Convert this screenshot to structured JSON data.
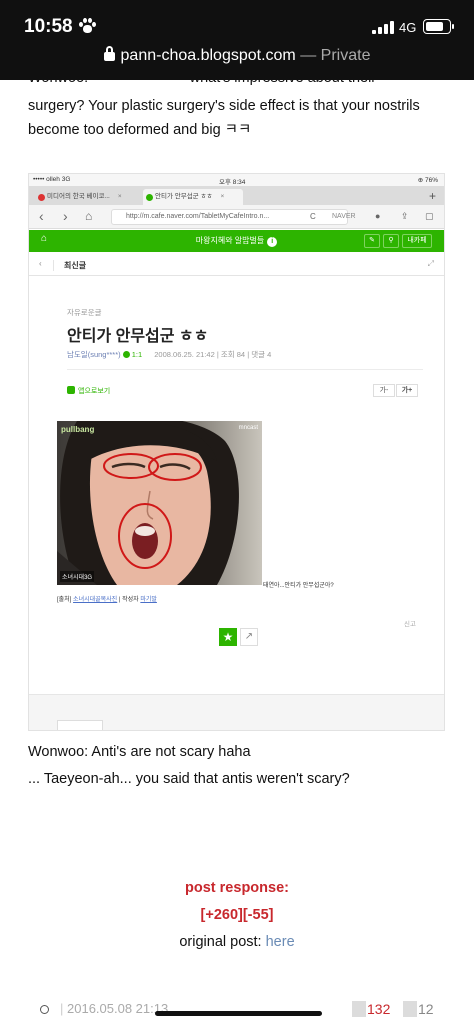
{
  "status_bar": {
    "time": "10:58",
    "network": "4G"
  },
  "address_bar": {
    "url": "pann-choa.blogspot.com",
    "mode": "— Private"
  },
  "article": {
    "cut_line": "Wonwoo: ㅋㅋㅋㅋㅋㅋㅋ what's impressive about their",
    "para1": "surgery? Your plastic surgery's side effect is that your nostrils become too deformed and big ㅋㅋ",
    "para2_line1": "Wonwoo: Anti's are not scary haha",
    "para2_line2": "... Taeyeon-ah... you said that antis weren't scary?",
    "post_response_label": "post response:",
    "votes": "[+260][-55]",
    "original_post_label": "original post:",
    "original_post_link": "here"
  },
  "screenshot": {
    "ipad_status": {
      "carrier": "••••• olleh  3G",
      "time": "오후 8:34",
      "battery": "⊕ 76%"
    },
    "tabs": [
      {
        "label": "미디어의 한국 베이코..."
      },
      {
        "label": "안티가 안무섭군 ㅎㅎ"
      }
    ],
    "tab_close": "×",
    "new_tab": "+",
    "nav": {
      "back": "‹",
      "forward": "›",
      "home": "⌂",
      "url": "http://m.cafe.naver.com/TabletMyCafeIntro.n...",
      "reload": "C",
      "search_engine": "NAVER"
    },
    "cafe_title": "마왕지혜와 알밥벌들",
    "info_mark": "i",
    "my_cafe": "내카페",
    "latest": "최신글",
    "category": "자유로운글",
    "post_title": "안티가 안무섭군 ㅎㅎ",
    "post_meta": {
      "author": "남도일(sung****)",
      "level": "1:1",
      "datetime": "2008.06.25. 21:42",
      "views": "조회 84",
      "comments": "댓글 4"
    },
    "app_view": "앱으로보기",
    "font_smaller": "가-",
    "font_larger": "가+",
    "watermark_left": "pullbang",
    "watermark_right": "mncast",
    "photo_tag": "소녀시대3G",
    "caption": "태연아...안티가 안무섭군아?",
    "source": {
      "prefix": "[출처]",
      "link": "소녀시대골목사진",
      "writer_label": "작성자",
      "writer": "마기말"
    },
    "report": "신고",
    "star": "★",
    "share": "↗"
  },
  "footer": {
    "date": "2016.05.08 21:13",
    "upvotes": "132",
    "downvotes": "12"
  },
  "colors": {
    "naver_green": "#2db400",
    "vote_red": "#c8282d",
    "link_blue": "#6a8bb5"
  }
}
